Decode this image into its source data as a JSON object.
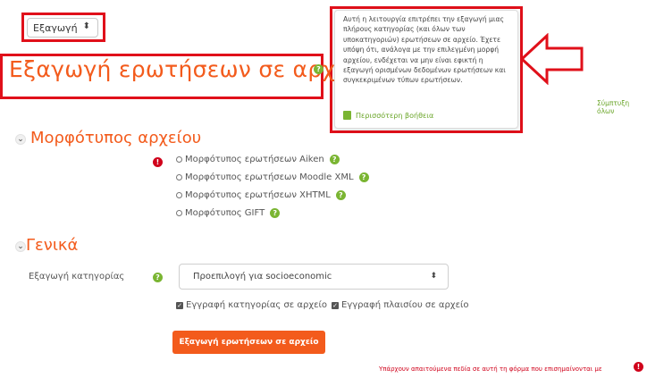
{
  "top_select": {
    "value": "Εξαγωγή",
    "caret": "⬍"
  },
  "page": {
    "title": "Εξαγωγή ερωτήσεων σε αρχείο",
    "help_icon": "?"
  },
  "popover": {
    "text": "Αυτή η λειτουργία επιτρέπει την εξαγωγή μιας πλήρους κατηγορίας (και όλων των υποκατηγοριών) ερωτήσεων σε αρχείο. Έχετε υπόψη ότι, ανάλογα με την επιλεγμένη μορφή αρχείου, ενδέχεται να μην είναι εφικτή η εξαγωγή ορισμένων δεδομένων ερωτήσεων και συγκεκριμένων τύπων ερωτήσεων.",
    "more_help": "Περισσότερη βοήθεια"
  },
  "expand_all": "Σύμπτυξη όλων",
  "sections": {
    "format": {
      "title": "Μορφότυπος αρχείου",
      "toggle": "⌄",
      "options": [
        {
          "label": "Μορφότυπος ερωτήσεων Aiken"
        },
        {
          "label": "Μορφότυπος ερωτήσεων Moodle XML"
        },
        {
          "label": "Μορφότυπος ερωτήσεων XHTML"
        },
        {
          "label": "Μορφότυπος GIFT"
        }
      ]
    },
    "general": {
      "title": "Γενικά",
      "toggle": "⌄",
      "export_category_label": "Εξαγωγή κατηγορίας",
      "category_select_value": "Προεπιλογή για socioeconomic",
      "category_caret": "⬍",
      "checkbox_category": "Εγγραφή κατηγορίας σε αρχείο",
      "checkbox_context": "Εγγραφή πλαισίου σε αρχείο",
      "checkbox_mark": "✓"
    }
  },
  "export_button": "Εξαγωγή ερωτήσεων σε αρχείο",
  "required_note": "Υπάρχουν απαιτούμενα πεδία σε αυτή τη φόρμα που επισημαίνονται με",
  "icons": {
    "help": "question-circle-icon",
    "required": "exclamation-circle-icon",
    "required_glyph": "!",
    "more_help": "book-icon",
    "arrow": "left-arrow-annotation"
  },
  "colors": {
    "accent": "#f35b1c",
    "help_green": "#7ab532",
    "required_red": "#d0021b",
    "annotation_red": "#e0101a"
  }
}
